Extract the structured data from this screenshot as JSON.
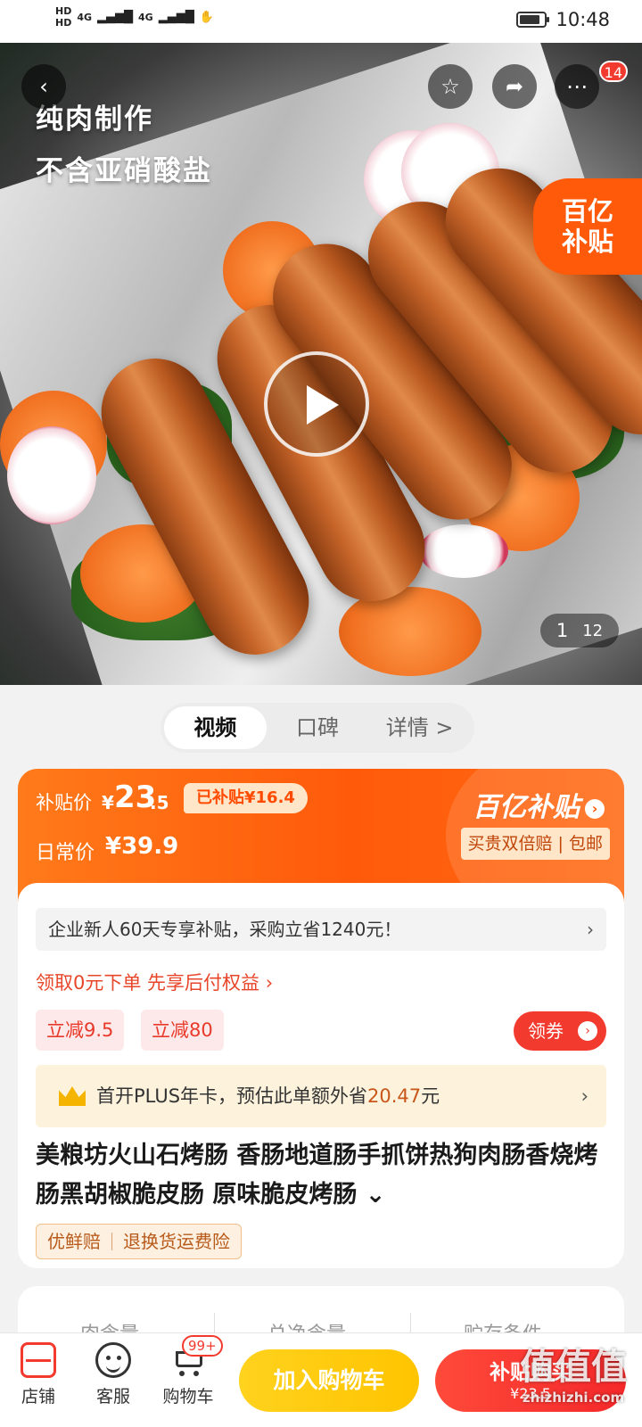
{
  "status_bar": {
    "hd1": "HD",
    "hd2": "HD",
    "signal1": "4G",
    "signal2": "4G",
    "time": "10:48"
  },
  "hero": {
    "overlay_line1": "纯肉制作",
    "overlay_line2": "不含亚硝酸盐",
    "badge_line1": "百亿",
    "badge_line2": "补贴",
    "more_badge": "14",
    "pager_current": "1",
    "pager_total": "12",
    "icons": {
      "back": "back-arrow-icon",
      "favorite": "star-icon",
      "share": "share-icon",
      "more": "more-dots-icon",
      "play": "play-icon"
    }
  },
  "tabs": [
    {
      "label": "视频",
      "active": true
    },
    {
      "label": "口碑",
      "active": false
    },
    {
      "label": "详情 >",
      "active": false
    }
  ],
  "price": {
    "subsidy_label": "补贴价",
    "subsidy_currency": "¥",
    "subsidy_int": "23",
    "subsidy_dec": ".5",
    "subsidized_tag": "已补贴¥16.4",
    "daily_label": "日常价",
    "daily_value": "¥39.9",
    "program_title": "百亿补贴",
    "program_sub": "买贵双倍赔 | 包邮"
  },
  "promo": {
    "enterprise": "企业新人60天专享补贴，采购立省1240元！",
    "paylater": "领取0元下单 先享后付权益 ›",
    "discount1": "立减9.5",
    "discount2": "立减80",
    "coupon_label": "领券",
    "plus_prefix": "首开PLUS年卡，预估此单额外省",
    "plus_amount": "20.47",
    "plus_suffix": "元"
  },
  "product": {
    "title": "美粮坊火山石烤肠 香肠地道肠手抓饼热狗肉肠香烧烤肠黑胡椒脆皮肠 原味脆皮烤肠 ⌄",
    "guarantee1": "优鲜赔",
    "guarantee2": "退换货运费险"
  },
  "specs": [
    "肉含量",
    "总净含量",
    "贮存条件"
  ],
  "bottom_bar": {
    "shop_label": "店铺",
    "service_label": "客服",
    "cart_label": "购物车",
    "cart_badge": "99+",
    "add_to_cart": "加入购物车",
    "buy_now": "补贴购买",
    "buy_price": "¥23.5"
  },
  "watermark": {
    "main": "值值值",
    "sub": "zhizhizhi.com"
  },
  "colors": {
    "accent_red": "#f23a2e",
    "subsidy_orange": "#ff5a0a",
    "cart_yellow": "#ffc400"
  }
}
